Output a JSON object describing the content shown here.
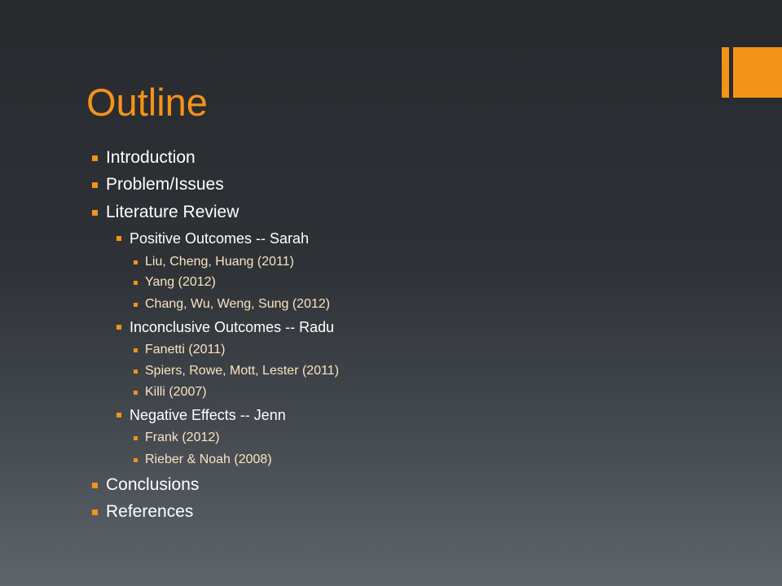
{
  "slide": {
    "title": "Outline",
    "accent_color": "#f39318",
    "text_color": "#ffffff",
    "subitem_color": "#fbe3bf",
    "background_top": "#27292d",
    "background_bottom": "#5e656c",
    "bullet_icon": "square-bullet-icon",
    "items": [
      {
        "label": "Introduction",
        "level": 1
      },
      {
        "label": "Problem/Issues",
        "level": 1
      },
      {
        "label": "Literature Review",
        "level": 1
      },
      {
        "label": "Positive Outcomes -- Sarah",
        "level": 2
      },
      {
        "label": "Liu, Cheng, Huang (2011)",
        "level": 3
      },
      {
        "label": "Yang (2012)",
        "level": 3
      },
      {
        "label": "Chang, Wu, Weng, Sung (2012)",
        "level": 3
      },
      {
        "label": "Inconclusive Outcomes -- Radu",
        "level": 2
      },
      {
        "label": "Fanetti (2011)",
        "level": 3
      },
      {
        "label": "Spiers, Rowe, Mott, Lester (2011)",
        "level": 3
      },
      {
        "label": "Killi (2007)",
        "level": 3
      },
      {
        "label": "Negative Effects -- Jenn",
        "level": 2
      },
      {
        "label": "Frank (2012)",
        "level": 3
      },
      {
        "label": "Rieber & Noah (2008)",
        "level": 3
      },
      {
        "label": "Conclusions",
        "level": 1
      },
      {
        "label": "References",
        "level": 1
      }
    ]
  }
}
